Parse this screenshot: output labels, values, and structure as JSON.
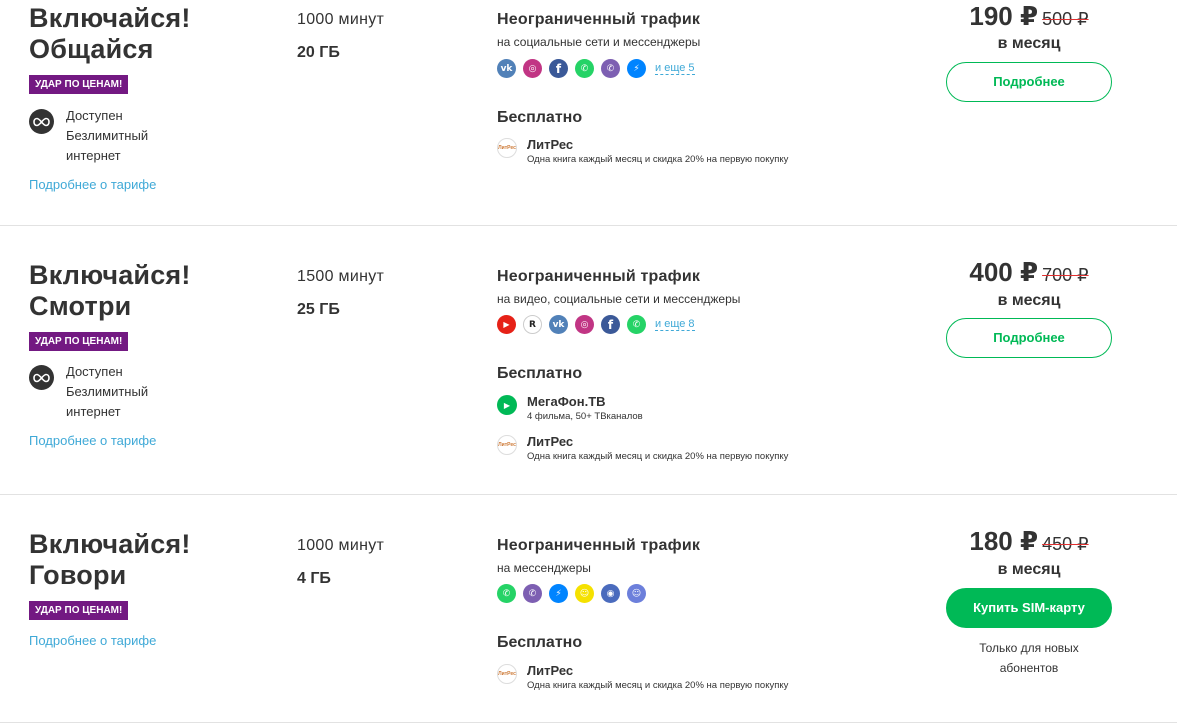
{
  "tariffs": [
    {
      "title_line1": "Включайся!",
      "title_line2": "Общайся",
      "badge": "УДАР ПО ЦЕНАМ!",
      "unlim_line1": "Доступен",
      "unlim_line2": "Безлимитный",
      "unlim_line3": "интернет",
      "more_link": "Подробнее о тарифе",
      "minutes": "1000 минут",
      "gb": "20 ГБ",
      "traffic_title": "Неограниченный трафик",
      "traffic_sub": "на социальные сети и мессенджеры",
      "icons": [
        {
          "name": "vk-icon",
          "color": "#5181b8",
          "glyph": "vk"
        },
        {
          "name": "instagram-icon",
          "color": "#c13584",
          "glyph": "◎"
        },
        {
          "name": "facebook-icon",
          "color": "#3b5998",
          "glyph": "f"
        },
        {
          "name": "whatsapp-icon",
          "color": "#25d366",
          "glyph": "✆"
        },
        {
          "name": "viber-icon",
          "color": "#7d5fb2",
          "glyph": "✆"
        },
        {
          "name": "messenger-icon",
          "color": "#0084ff",
          "glyph": "⚡"
        }
      ],
      "more_apps": "и еще 5",
      "free_title": "Бесплатно",
      "services": [
        {
          "name": "ЛитРес",
          "desc": "Одна книга каждый месяц и скидка 20% на первую покупку",
          "icon": "litres-icon",
          "icon_text": "ЛитРес"
        }
      ],
      "price": "190 ₽",
      "old_price": "500 ₽",
      "per_month": "в месяц",
      "button": "Подробнее"
    },
    {
      "title_line1": "Включайся!",
      "title_line2": "Смотри",
      "badge": "УДАР ПО ЦЕНАМ!",
      "unlim_line1": "Доступен",
      "unlim_line2": "Безлимитный",
      "unlim_line3": "интернет",
      "more_link": "Подробнее о тарифе",
      "minutes": "1500 минут",
      "gb": "25 ГБ",
      "traffic_title": "Неограниченный трафик",
      "traffic_sub": "на видео, социальные сети и мессенджеры",
      "icons": [
        {
          "name": "youtube-icon",
          "color": "#e62117",
          "glyph": "▶"
        },
        {
          "name": "rutube-icon",
          "color": "#ffffff",
          "glyph": "R"
        },
        {
          "name": "vk-icon",
          "color": "#5181b8",
          "glyph": "vk"
        },
        {
          "name": "instagram-icon",
          "color": "#c13584",
          "glyph": "◎"
        },
        {
          "name": "facebook-icon",
          "color": "#3b5998",
          "glyph": "f"
        },
        {
          "name": "whatsapp-icon",
          "color": "#25d366",
          "glyph": "✆"
        }
      ],
      "more_apps": "и еще 8",
      "free_title": "Бесплатно",
      "services": [
        {
          "name": "МегаФон.ТВ",
          "desc": "4 фильма, 50+ ТВканалов",
          "icon": "megafon-tv-icon",
          "icon_text": "▶"
        },
        {
          "name": "ЛитРес",
          "desc": "Одна книга каждый месяц и скидка 20% на первую покупку",
          "icon": "litres-icon",
          "icon_text": "ЛитРес"
        }
      ],
      "price": "400 ₽",
      "old_price": "700 ₽",
      "per_month": "в месяц",
      "button": "Подробнее"
    },
    {
      "title_line1": "Включайся!",
      "title_line2": "Говори",
      "badge": "УДАР ПО ЦЕНАМ!",
      "more_link": "Подробнее о тарифе",
      "minutes": "1000 минут",
      "gb": "4 ГБ",
      "traffic_title": "Неограниченный трафик",
      "traffic_sub": "на мессенджеры",
      "icons": [
        {
          "name": "whatsapp-icon",
          "color": "#25d366",
          "glyph": "✆"
        },
        {
          "name": "viber-icon",
          "color": "#7d5fb2",
          "glyph": "✆"
        },
        {
          "name": "messenger-icon",
          "color": "#0084ff",
          "glyph": "⚡"
        },
        {
          "name": "snapchat-icon",
          "color": "#f5e100",
          "glyph": "☺"
        },
        {
          "name": "tamtam-icon",
          "color": "#4a6bbd",
          "glyph": "◉"
        },
        {
          "name": "icq-icon",
          "color": "#6c7fdb",
          "glyph": "☺"
        }
      ],
      "free_title": "Бесплатно",
      "services": [
        {
          "name": "ЛитРес",
          "desc": "Одна книга каждый месяц и скидка 20% на первую покупку",
          "icon": "litres-icon",
          "icon_text": "ЛитРес"
        }
      ],
      "price": "180 ₽",
      "old_price": "450 ₽",
      "per_month": "в месяц",
      "button": "Купить SIM-карту",
      "note_line1": "Только для новых",
      "note_line2": "абонентов"
    }
  ]
}
